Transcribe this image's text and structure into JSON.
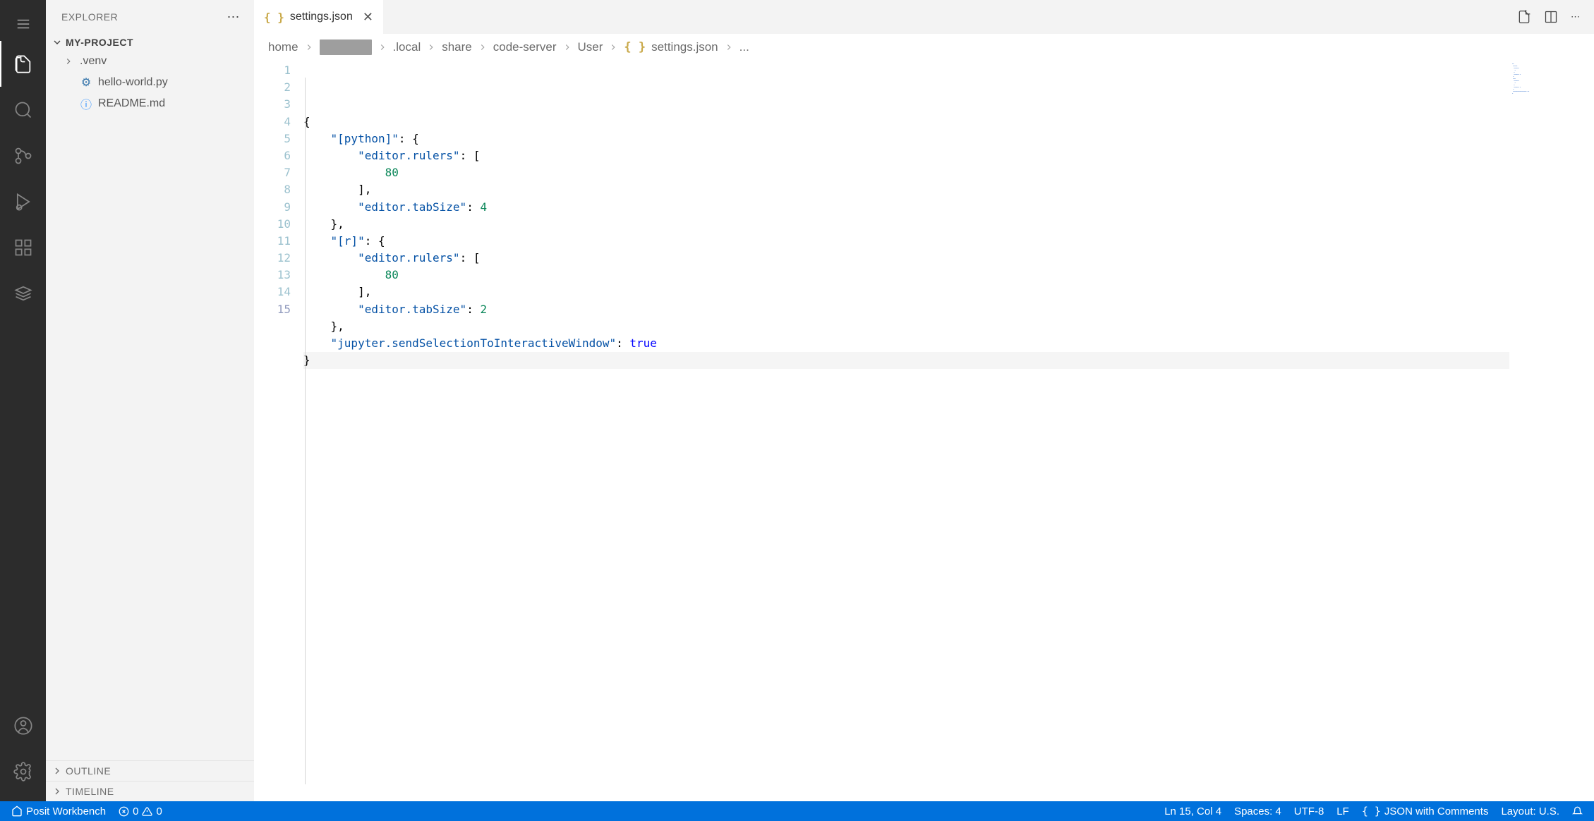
{
  "sidebar": {
    "title": "EXPLORER",
    "project": "MY-PROJECT",
    "items": [
      {
        "label": ".venv",
        "type": "folder"
      },
      {
        "label": "hello-world.py",
        "type": "python"
      },
      {
        "label": "README.md",
        "type": "info"
      }
    ],
    "bottom": [
      {
        "label": "OUTLINE"
      },
      {
        "label": "TIMELINE"
      }
    ]
  },
  "tab": {
    "label": "settings.json",
    "icon": "braces-icon"
  },
  "breadcrumbs": {
    "items": [
      "home",
      "",
      ".local",
      "share",
      "code-server",
      "User"
    ],
    "file": "settings.json",
    "tail": "..."
  },
  "editor": {
    "line_count": 15,
    "active_line": 15,
    "code_tokens": [
      [
        {
          "t": "{",
          "c": "brace"
        }
      ],
      [
        {
          "t": "    ",
          "c": ""
        },
        {
          "t": "\"[python]\"",
          "c": "key"
        },
        {
          "t": ": {",
          "c": "punc"
        }
      ],
      [
        {
          "t": "        ",
          "c": ""
        },
        {
          "t": "\"editor.rulers\"",
          "c": "key"
        },
        {
          "t": ": [",
          "c": "punc"
        }
      ],
      [
        {
          "t": "            ",
          "c": ""
        },
        {
          "t": "80",
          "c": "num"
        }
      ],
      [
        {
          "t": "        ",
          "c": ""
        },
        {
          "t": "],",
          "c": "punc"
        }
      ],
      [
        {
          "t": "        ",
          "c": ""
        },
        {
          "t": "\"editor.tabSize\"",
          "c": "key"
        },
        {
          "t": ": ",
          "c": "punc"
        },
        {
          "t": "4",
          "c": "num"
        }
      ],
      [
        {
          "t": "    ",
          "c": ""
        },
        {
          "t": "},",
          "c": "punc"
        }
      ],
      [
        {
          "t": "    ",
          "c": ""
        },
        {
          "t": "\"[r]\"",
          "c": "key"
        },
        {
          "t": ": {",
          "c": "punc"
        }
      ],
      [
        {
          "t": "        ",
          "c": ""
        },
        {
          "t": "\"editor.rulers\"",
          "c": "key"
        },
        {
          "t": ": [",
          "c": "punc"
        }
      ],
      [
        {
          "t": "            ",
          "c": ""
        },
        {
          "t": "80",
          "c": "num"
        }
      ],
      [
        {
          "t": "        ",
          "c": ""
        },
        {
          "t": "],",
          "c": "punc"
        }
      ],
      [
        {
          "t": "        ",
          "c": ""
        },
        {
          "t": "\"editor.tabSize\"",
          "c": "key"
        },
        {
          "t": ": ",
          "c": "punc"
        },
        {
          "t": "2",
          "c": "num"
        }
      ],
      [
        {
          "t": "    ",
          "c": ""
        },
        {
          "t": "},",
          "c": "punc"
        }
      ],
      [
        {
          "t": "    ",
          "c": ""
        },
        {
          "t": "\"jupyter.sendSelectionToInteractiveWindow\"",
          "c": "key"
        },
        {
          "t": ": ",
          "c": "punc"
        },
        {
          "t": "true",
          "c": "bool"
        }
      ],
      [
        {
          "t": "}",
          "c": "brace"
        }
      ]
    ]
  },
  "statusbar": {
    "remote": "Posit Workbench",
    "errors": "0",
    "warnings": "0",
    "cursor": "Ln 15, Col 4",
    "spaces": "Spaces: 4",
    "encoding": "UTF-8",
    "eol": "LF",
    "language": "JSON with Comments",
    "layout": "Layout: U.S."
  }
}
